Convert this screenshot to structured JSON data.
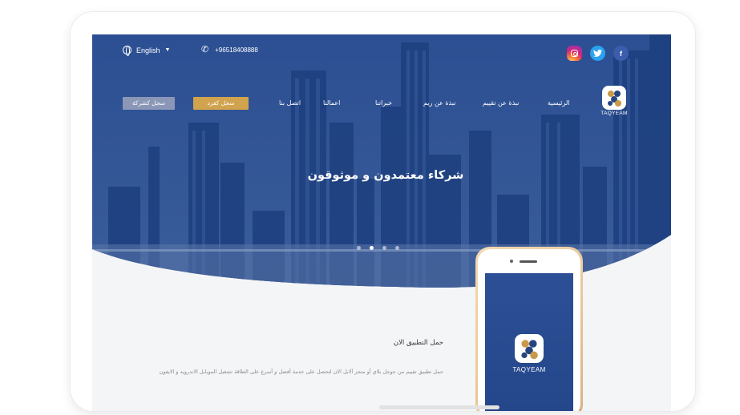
{
  "topbar": {
    "language": "English",
    "language_icon": "globe-icon",
    "phone": "+96518408888",
    "phone_icon": "phone-icon",
    "socials": [
      {
        "name": "instagram-icon",
        "color": "#d6247b"
      },
      {
        "name": "twitter-icon",
        "color": "#2aa3ef",
        "glyph": "t"
      },
      {
        "name": "facebook-icon",
        "color": "#3b5dab",
        "glyph": "f"
      }
    ]
  },
  "nav": {
    "items": [
      {
        "label": "الرئيسية"
      },
      {
        "label": "نبذة عن تقييم"
      },
      {
        "label": "نبذة عن ريم"
      },
      {
        "label": "خبراتنا"
      },
      {
        "label": "اعمالنا"
      },
      {
        "label": "اتصل بنا"
      }
    ],
    "register_individual": "سجل كفرد",
    "register_company": "سجل كشركة"
  },
  "logo": {
    "caption": "TAQYEAM"
  },
  "hero": {
    "headline": "شركاء معتمدون و موثوقون",
    "slides": 4,
    "active_slide": 2
  },
  "download": {
    "title": "حمل التطبيق الان",
    "text": "حمل تطبيق تقييم من جوجل بلاي أو متجر آلابل الان لتحصل على خدمة أفضل و أسرع على الطاقة تشغيل الموبايل الاندرويد و الايفون"
  },
  "mockup": {
    "caption": "TAQYEAM"
  },
  "colors": {
    "hero_blue": "#254a8f",
    "gold": "#d1a34e",
    "company_button": "#8a97b6"
  }
}
